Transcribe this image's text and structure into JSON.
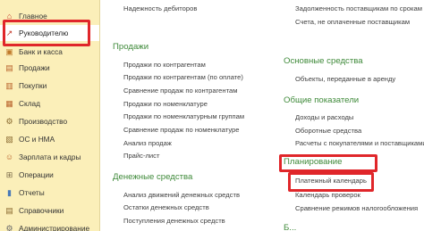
{
  "sidebar": {
    "items": [
      {
        "label": "Главное",
        "icon": "home-icon",
        "glyph": "⌂",
        "color": "#c43a2a"
      },
      {
        "label": "Руководителю",
        "icon": "chart-line-icon",
        "glyph": "↗",
        "color": "#c43a2a",
        "active": true
      },
      {
        "label": "Банк и касса",
        "icon": "bank-icon",
        "glyph": "▣",
        "color": "#c07a2a"
      },
      {
        "label": "Продажи",
        "icon": "cart-icon",
        "glyph": "▤",
        "color": "#b8622b"
      },
      {
        "label": "Покупки",
        "icon": "basket-icon",
        "glyph": "▥",
        "color": "#b8622b"
      },
      {
        "label": "Склад",
        "icon": "warehouse-icon",
        "glyph": "▦",
        "color": "#b8622b"
      },
      {
        "label": "Производство",
        "icon": "factory-icon",
        "glyph": "⚙",
        "color": "#8a6a30"
      },
      {
        "label": "ОС и НМА",
        "icon": "assets-icon",
        "glyph": "▧",
        "color": "#8a6a30"
      },
      {
        "label": "Зарплата и кадры",
        "icon": "people-icon",
        "glyph": "☺",
        "color": "#b8622b"
      },
      {
        "label": "Операции",
        "icon": "operations-icon",
        "glyph": "⊞",
        "color": "#7a6a4a"
      },
      {
        "label": "Отчеты",
        "icon": "reports-icon",
        "glyph": "▮",
        "color": "#4a7ab8"
      },
      {
        "label": "Справочники",
        "icon": "book-icon",
        "glyph": "▤",
        "color": "#8a6a30"
      },
      {
        "label": "Администрирование",
        "icon": "admin-icon",
        "glyph": "⚙",
        "color": "#6a6a6a"
      }
    ]
  },
  "left_column": {
    "top_link": "Надежность дебиторов",
    "sales": {
      "title": "Продажи",
      "links": [
        "Продажи по контрагентам",
        "Продажи по контрагентам (по оплате)",
        "Сравнение продаж по контрагентам",
        "Продажи по номенклатуре",
        "Продажи по номенклатурным группам",
        "Сравнение продаж по номенклатуре",
        "Анализ продаж",
        "Прайс-лист"
      ]
    },
    "cash": {
      "title": "Денежные средства",
      "links": [
        "Анализ движений денежных средств",
        "Остатки денежных средств",
        "Поступления денежных средств"
      ]
    }
  },
  "right_column": {
    "top_links": [
      "Задолженность поставщикам по срокам",
      "Счета, не оплаченные поставщикам"
    ],
    "fixed_assets": {
      "title": "Основные средства",
      "links": [
        "Объекты, переданные в аренду"
      ]
    },
    "indicators": {
      "title": "Общие показатели",
      "links": [
        "Доходы и расходы",
        "Оборотные средства",
        "Расчеты с покупателями и поставщиками"
      ]
    },
    "planning": {
      "title": "Планирование",
      "links": [
        "Платежный календарь",
        "Календарь проверок",
        "Сравнение режимов налогообложения"
      ]
    },
    "bottom_partial": "Б..."
  },
  "colors": {
    "sidebar_bg": "#fbefb9",
    "section_title": "#3f8a3a",
    "highlight": "#e0262a"
  }
}
